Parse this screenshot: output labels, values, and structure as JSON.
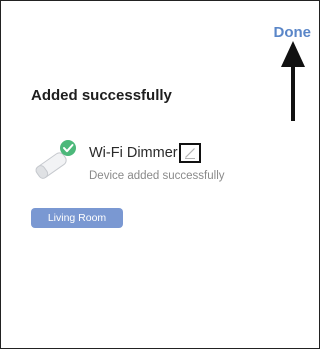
{
  "header": {
    "done_label": "Done"
  },
  "page": {
    "title": "Added successfully"
  },
  "device": {
    "name": "Wi-Fi Dimmer",
    "status": "Device added successfully",
    "icon": "dimmer-device-icon",
    "badge_icon": "check-badge-icon",
    "edit_icon": "pencil-icon"
  },
  "room": {
    "label": "Living Room"
  },
  "colors": {
    "accent": "#5a86c8",
    "chip": "#7a98d2",
    "success": "#4cb87a"
  }
}
